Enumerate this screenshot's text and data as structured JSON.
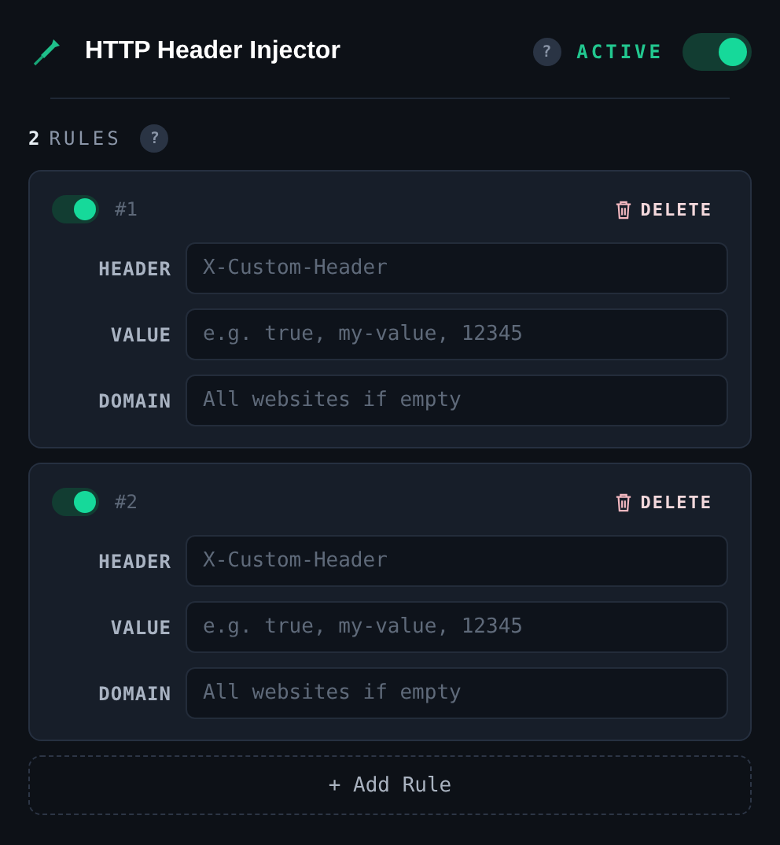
{
  "header": {
    "title": "HTTP Header Injector",
    "help": "?",
    "status": "ACTIVE",
    "on": true
  },
  "rules_summary": {
    "count": "2",
    "label": "RULES",
    "help": "?"
  },
  "rules": [
    {
      "number": "#1",
      "on": true,
      "delete": "DELETE",
      "fields": [
        {
          "label": "HEADER",
          "placeholder": "X-Custom-Header"
        },
        {
          "label": "VALUE",
          "placeholder": "e.g. true, my-value, 12345"
        },
        {
          "label": "DOMAIN",
          "placeholder": "All websites if empty"
        }
      ]
    },
    {
      "number": "#2",
      "on": true,
      "delete": "DELETE",
      "fields": [
        {
          "label": "HEADER",
          "placeholder": "X-Custom-Header"
        },
        {
          "label": "VALUE",
          "placeholder": "e.g. true, my-value, 12345"
        },
        {
          "label": "DOMAIN",
          "placeholder": "All websites if empty"
        }
      ]
    }
  ],
  "add_button": "+ Add Rule"
}
